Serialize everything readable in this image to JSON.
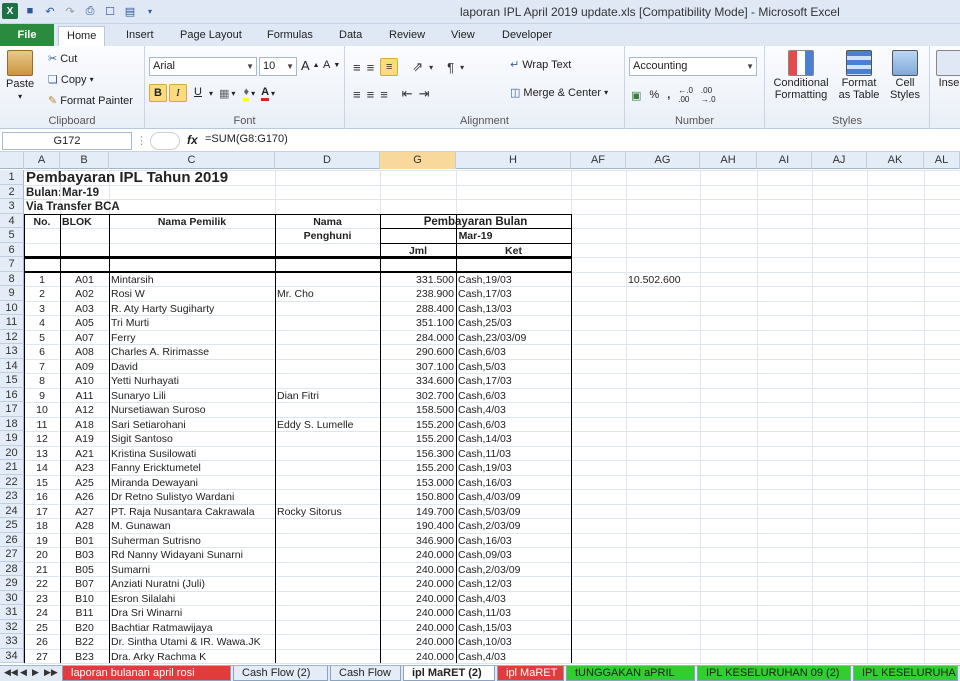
{
  "window": {
    "title": "laporan IPL April 2019 update.xls  [Compatibility Mode]  -  Microsoft Excel"
  },
  "ribbon_tabs": [
    "File",
    "Home",
    "Insert",
    "Page Layout",
    "Formulas",
    "Data",
    "Review",
    "View",
    "Developer"
  ],
  "ribbon": {
    "clipboard": {
      "label": "Clipboard",
      "paste": "Paste",
      "cut": "Cut",
      "copy": "Copy",
      "format_painter": "Format Painter"
    },
    "font": {
      "label": "Font",
      "name": "Arial",
      "size": "10",
      "bold": "B",
      "italic": "I",
      "underline": "U"
    },
    "alignment": {
      "label": "Alignment",
      "wrap": "Wrap Text",
      "merge": "Merge & Center"
    },
    "number": {
      "label": "Number",
      "format": "Accounting",
      "percent": "%",
      "comma": ",",
      "inc": ".0 .00",
      "dec": ".00 .0"
    },
    "styles": {
      "label": "Styles",
      "conditional": "Conditional Formatting",
      "format_table": "Format as Table",
      "cell_styles": "Cell Styles"
    },
    "cells": {
      "insert": "Inse"
    }
  },
  "formula_bar": {
    "name_box": "G172",
    "fx": "fx",
    "formula": "=SUM(G8:G170)"
  },
  "columns": [
    "A",
    "B",
    "C",
    "D",
    "G",
    "H",
    "AF",
    "AG",
    "AH",
    "AI",
    "AJ",
    "AK",
    "AL"
  ],
  "sheet": {
    "title": "Pembayaran IPL Tahun 2019",
    "bulan_label": "Bulan:",
    "bulan_value": "Mar-19",
    "via": "Via Transfer BCA",
    "header": {
      "no": "No.",
      "blok": "BLOK",
      "nama_pemilik": "Nama Pemilik",
      "nama": "Nama",
      "penghuni": "Penghuni",
      "pembayaran": "Pembayaran Bulan",
      "bulan": "Mar-19",
      "jml": "Jml",
      "ket": "Ket"
    },
    "total_label": "10.502.600",
    "row_numbers": [
      "1",
      "2",
      "3",
      "4",
      "5",
      "6",
      "7",
      "8",
      "9",
      "10",
      "11",
      "12",
      "13",
      "14",
      "15",
      "16",
      "17",
      "18",
      "19",
      "20",
      "21",
      "22",
      "23",
      "24",
      "25",
      "26",
      "27",
      "28",
      "29",
      "30",
      "31",
      "32",
      "33",
      "34"
    ],
    "rows": [
      [
        "1",
        "A01",
        "Mintarsih",
        "",
        "331.500",
        "Cash,19/03"
      ],
      [
        "2",
        "A02",
        "Rosi W",
        "Mr. Cho",
        "238.900",
        "Cash,17/03"
      ],
      [
        "3",
        "A03",
        "R. Aty Harty Sugiharty",
        "",
        "288.400",
        "Cash,13/03"
      ],
      [
        "4",
        "A05",
        "Tri Murti",
        "",
        "351.100",
        "Cash,25/03"
      ],
      [
        "5",
        "A07",
        "Ferry",
        "",
        "284.000",
        "Cash,23/03/09"
      ],
      [
        "6",
        "A08",
        "Charles A. Ririmasse",
        "",
        "290.600",
        "Cash,6/03"
      ],
      [
        "7",
        "A09",
        "David",
        "",
        "307.100",
        "Cash,5/03"
      ],
      [
        "8",
        "A10",
        "Yetti Nurhayati",
        "",
        "334.600",
        "Cash,17/03"
      ],
      [
        "9",
        "A11",
        "Sunaryo Lili",
        "Dian Fitri",
        "302.700",
        "Cash,6/03"
      ],
      [
        "10",
        "A12",
        "Nursetiawan Suroso",
        "",
        "158.500",
        "Cash,4/03"
      ],
      [
        "11",
        "A18",
        "Sari Setiarohani",
        "Eddy S. Lumelle",
        "155.200",
        "Cash,6/03"
      ],
      [
        "12",
        "A19",
        "Sigit Santoso",
        "",
        "155.200",
        "Cash,14/03"
      ],
      [
        "13",
        "A21",
        "Kristina Susilowati",
        "",
        "156.300",
        "Cash,11/03"
      ],
      [
        "14",
        "A23",
        "Fanny Ericktumetel",
        "",
        "155.200",
        "Cash,19/03"
      ],
      [
        "15",
        "A25",
        "Miranda Dewayani",
        "",
        "153.000",
        "Cash,16/03"
      ],
      [
        "16",
        "A26",
        "Dr Retno Sulistyo Wardani",
        "",
        "150.800",
        "Cash,4/03/09"
      ],
      [
        "17",
        "A27",
        "PT. Raja Nusantara Cakrawala",
        "Rocky Sitorus",
        "149.700",
        "Cash,5/03/09"
      ],
      [
        "18",
        "A28",
        "M. Gunawan",
        "",
        "190.400",
        "Cash,2/03/09"
      ],
      [
        "19",
        "B01",
        "Suherman Sutrisno",
        "",
        "346.900",
        "Cash,16/03"
      ],
      [
        "20",
        "B03",
        "Rd Nanny Widayani Sunarni",
        "",
        "240.000",
        "Cash,09/03"
      ],
      [
        "21",
        "B05",
        "Sumarni",
        "",
        "240.000",
        "Cash,2/03/09"
      ],
      [
        "22",
        "B07",
        "Anziati Nuratni (Juli)",
        "",
        "240.000",
        "Cash,12/03"
      ],
      [
        "23",
        "B10",
        "Esron Silalahi",
        "",
        "240.000",
        "Cash,4/03"
      ],
      [
        "24",
        "B11",
        "Dra Sri Winarni",
        "",
        "240.000",
        "Cash,11/03"
      ],
      [
        "25",
        "B20",
        "Bachtiar Ratmawijaya",
        "",
        "240.000",
        "Cash,15/03"
      ],
      [
        "26",
        "B22",
        "Dr. Sintha Utami & IR. Wawa.JK",
        "",
        "240.000",
        "Cash,10/03"
      ],
      [
        "27",
        "B23",
        "Dra. Arky Rachma K",
        "",
        "240.000",
        "Cash,4/03"
      ]
    ]
  },
  "sheet_tabs": [
    {
      "label": "laporan bulanan april rosi",
      "color": "#e23b3b"
    },
    {
      "label": "Cash Flow (2)",
      "color": "#e4ecf7"
    },
    {
      "label": "Cash Flow",
      "color": "#e4ecf7"
    },
    {
      "label": "ipl MaRET (2)",
      "color": "#ffffff"
    },
    {
      "label": "ipl MaRET",
      "color": "#e23b3b"
    },
    {
      "label": "tUNGGAKAN aPRIL",
      "color": "#2fcf2f"
    },
    {
      "label": "IPL KESELURUHAN 09 (2)",
      "color": "#2fcf2f"
    },
    {
      "label": "IPL KESELURUHA",
      "color": "#2fcf2f"
    }
  ]
}
